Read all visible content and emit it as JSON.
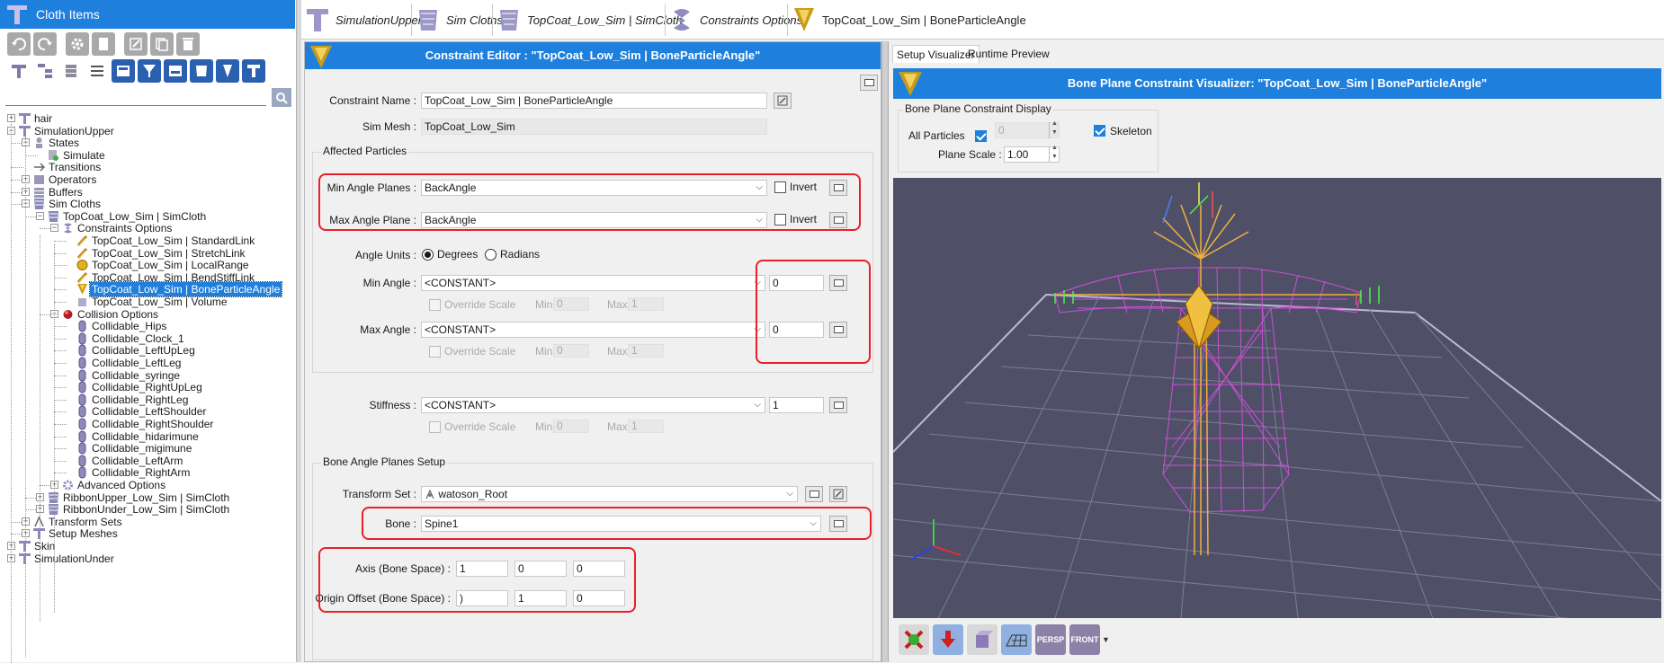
{
  "left_panel": {
    "title": "Cloth Items",
    "tree": [
      {
        "label": "hair",
        "level": 0,
        "expander": "+",
        "icon": "t"
      },
      {
        "label": "SimulationUpper",
        "level": 0,
        "expander": "-",
        "icon": "t"
      },
      {
        "label": "States",
        "level": 1,
        "expander": "-",
        "icon": "states"
      },
      {
        "label": "Simulate",
        "level": 2,
        "expander": "",
        "icon": "simulate"
      },
      {
        "label": "Transitions",
        "level": 1,
        "expander": "",
        "icon": "transitions"
      },
      {
        "label": "Operators",
        "level": 1,
        "expander": "+",
        "icon": "operators"
      },
      {
        "label": "Buffers",
        "level": 1,
        "expander": "+",
        "icon": "buffers"
      },
      {
        "label": "Sim Cloths",
        "level": 1,
        "expander": "-",
        "icon": "simcloth"
      },
      {
        "label": "TopCoat_Low_Sim | SimCloth",
        "level": 2,
        "expander": "-",
        "icon": "simcloth"
      },
      {
        "label": "Constraints Options",
        "level": 3,
        "expander": "-",
        "icon": "constraints"
      },
      {
        "label": "TopCoat_Low_Sim | StandardLink",
        "level": 4,
        "expander": "",
        "icon": "link"
      },
      {
        "label": "TopCoat_Low_Sim | StretchLink",
        "level": 4,
        "expander": "",
        "icon": "link"
      },
      {
        "label": "TopCoat_Low_Sim | LocalRange",
        "level": 4,
        "expander": "",
        "icon": "range"
      },
      {
        "label": "TopCoat_Low_Sim | BendStiffLink",
        "level": 4,
        "expander": "",
        "icon": "link"
      },
      {
        "label": "TopCoat_Low_Sim | BoneParticleAngle",
        "level": 4,
        "expander": "",
        "icon": "angle",
        "selected": true
      },
      {
        "label": "TopCoat_Low_Sim | Volume",
        "level": 4,
        "expander": "",
        "icon": "volume"
      },
      {
        "label": "Collision Options",
        "level": 3,
        "expander": "-",
        "icon": "collision"
      },
      {
        "label": "Collidable_Hips",
        "level": 4,
        "expander": "",
        "icon": "capsule"
      },
      {
        "label": "Collidable_Clock_1",
        "level": 4,
        "expander": "",
        "icon": "capsule"
      },
      {
        "label": "Collidable_LeftUpLeg",
        "level": 4,
        "expander": "",
        "icon": "capsule"
      },
      {
        "label": "Collidable_LeftLeg",
        "level": 4,
        "expander": "",
        "icon": "capsule"
      },
      {
        "label": "Collidable_syringe",
        "level": 4,
        "expander": "",
        "icon": "capsule"
      },
      {
        "label": "Collidable_RightUpLeg",
        "level": 4,
        "expander": "",
        "icon": "capsule"
      },
      {
        "label": "Collidable_RightLeg",
        "level": 4,
        "expander": "",
        "icon": "capsule"
      },
      {
        "label": "Collidable_LeftShoulder",
        "level": 4,
        "expander": "",
        "icon": "capsule"
      },
      {
        "label": "Collidable_RightShoulder",
        "level": 4,
        "expander": "",
        "icon": "capsule"
      },
      {
        "label": "Collidable_hidarimune",
        "level": 4,
        "expander": "",
        "icon": "capsule"
      },
      {
        "label": "Collidable_migimune",
        "level": 4,
        "expander": "",
        "icon": "capsule"
      },
      {
        "label": "Collidable_LeftArm",
        "level": 4,
        "expander": "",
        "icon": "capsule"
      },
      {
        "label": "Collidable_RightArm",
        "level": 4,
        "expander": "",
        "icon": "capsule"
      },
      {
        "label": "Advanced Options",
        "level": 3,
        "expander": "+",
        "icon": "advanced"
      },
      {
        "label": "RibbonUpper_Low_Sim | SimCloth",
        "level": 2,
        "expander": "+",
        "icon": "simcloth"
      },
      {
        "label": "RibbonUnder_Low_Sim | SimCloth",
        "level": 2,
        "expander": "+",
        "icon": "simcloth"
      },
      {
        "label": "Transform Sets",
        "level": 1,
        "expander": "+",
        "icon": "transforms"
      },
      {
        "label": "Setup Meshes",
        "level": 1,
        "expander": "+",
        "icon": "t"
      },
      {
        "label": "Skin",
        "level": 0,
        "expander": "+",
        "icon": "t"
      },
      {
        "label": "SimulationUnder",
        "level": 0,
        "expander": "+",
        "icon": "t"
      }
    ]
  },
  "tabs": [
    {
      "label": "SimulationUpper"
    },
    {
      "label": "Sim Cloths"
    },
    {
      "label": "TopCoat_Low_Sim | SimCloth"
    },
    {
      "label": "Constraints Options"
    },
    {
      "label": "TopCoat_Low_Sim | BoneParticleAngle"
    }
  ],
  "editor": {
    "title": "Constraint Editor : \"TopCoat_Low_Sim | BoneParticleAngle\"",
    "constraint_name_label": "Constraint Name :",
    "constraint_name": "TopCoat_Low_Sim | BoneParticleAngle",
    "sim_mesh_label": "Sim Mesh :",
    "sim_mesh": "TopCoat_Low_Sim",
    "affected_particles": "Affected Particles",
    "min_angle_planes_label": "Min Angle Planes :",
    "min_angle_planes": "BackAngle",
    "max_angle_plane_label": "Max Angle Plane :",
    "max_angle_plane": "BackAngle",
    "invert": "Invert",
    "angle_units_label": "Angle Units :",
    "degrees": "Degrees",
    "radians": "Radians",
    "min_angle_label": "Min Angle :",
    "min_angle_mode": "<CONSTANT>",
    "min_angle_value": "0",
    "max_angle_label": "Max Angle :",
    "max_angle_mode": "<CONSTANT>",
    "max_angle_value": "0",
    "override_scale": "Override Scale",
    "min": "Min",
    "max": "Max",
    "scale_min": "0",
    "scale_max": "1",
    "stiffness_label": "Stiffness :",
    "stiffness_mode": "<CONSTANT>",
    "stiffness_value": "1",
    "bone_planes_setup": "Bone Angle Planes Setup",
    "transform_set_label": "Transform Set :",
    "transform_set": "watoson_Root",
    "bone_label": "Bone :",
    "bone": "Spine1",
    "axis_label": "Axis (Bone Space) :",
    "axis": [
      "1",
      "0",
      "0"
    ],
    "origin_label": "Origin Offset (Bone Space) :",
    "origin": [
      ")",
      "1",
      "0"
    ]
  },
  "visualizer": {
    "tab_setup": "Setup Visualizer",
    "tab_runtime": "Runtime Preview",
    "title": "Bone Plane Constraint Visualizer: \"TopCoat_Low_Sim | BoneParticleAngle\"",
    "display_group": "Bone Plane Constraint Display",
    "all_particles": "All Particles",
    "particle_index": "0",
    "skeleton": "Skeleton",
    "plane_scale_label": "Plane Scale :",
    "plane_scale": "1.00",
    "toolbar": [
      {
        "icon": "reset-icon",
        "label": ""
      },
      {
        "icon": "drop-icon",
        "label": ""
      },
      {
        "icon": "cube-icon",
        "label": ""
      },
      {
        "icon": "grid-icon",
        "label": ""
      },
      {
        "icon": "persp-icon",
        "label": "PERSP"
      },
      {
        "icon": "front-icon",
        "label": "FRONT"
      }
    ]
  },
  "colors": {
    "accent": "#1f7fdc",
    "highlight_box": "#e8202a",
    "viewport_bg": "#4f5068",
    "mesh": "#d94fe0",
    "skeleton": "#f0b040"
  }
}
